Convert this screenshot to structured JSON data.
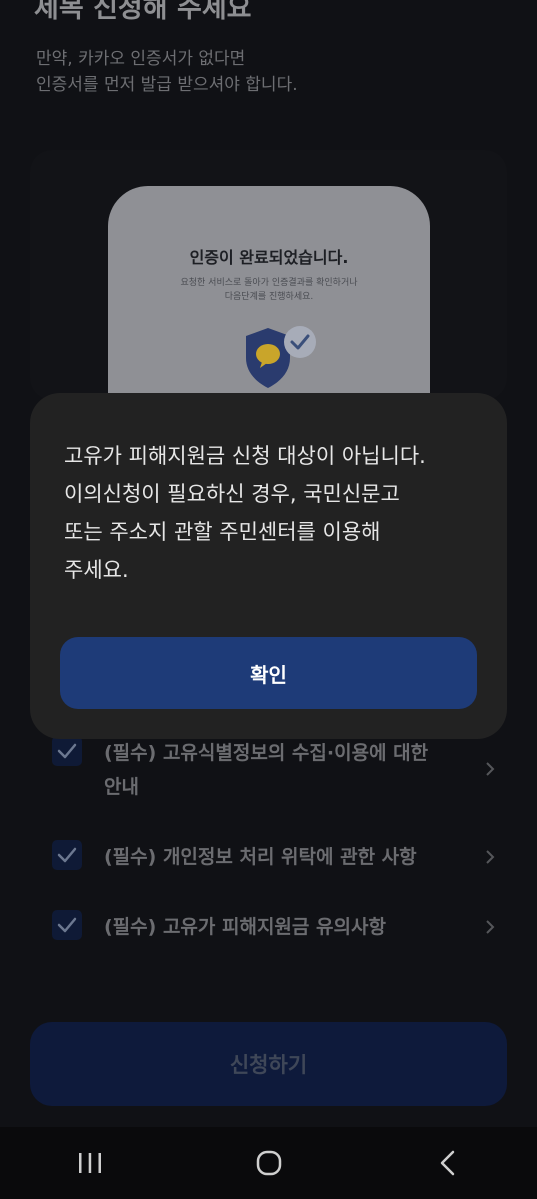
{
  "page": {
    "heading": "제목 신청해 주세요",
    "description_lines": [
      "만약, 카카오 인증서가 없다면",
      "인증서를 먼저 발급 받으셔야 합니다."
    ]
  },
  "illustration": {
    "title": "인증이 완료되었습니다.",
    "subtitle_lines": [
      "요청한 서비스로 돌아가 인증결과를 확인하거나",
      "다음단계를 진행하세요."
    ]
  },
  "dialog": {
    "message_lines": [
      "고유가 피해지원금 신청 대상이 아닙니다.",
      "이의신청이 필요하신 경우, 국민신문고",
      "또는 주소지 관할 주민센터를 이용해",
      "주세요."
    ],
    "confirm_label": "확인"
  },
  "agreements": [
    {
      "lines": [
        "(필수) 고유식별정보의 수집·이용에 대한",
        "안내"
      ],
      "checked": true
    },
    {
      "lines": [
        "(필수) 개인정보 처리 위탁에 관한 사항"
      ],
      "checked": true
    },
    {
      "lines": [
        "(필수) 고유가 피해지원금 유의사항"
      ],
      "checked": true
    }
  ],
  "apply_button": {
    "label": "신청하기"
  },
  "navbar": {
    "icons": [
      "recent-apps-icon",
      "home-icon",
      "back-icon"
    ]
  },
  "colors": {
    "background": "#101115",
    "dialog": "#222222",
    "confirm_button": "#1e3b78",
    "apply_button": "#0e1a3b"
  }
}
